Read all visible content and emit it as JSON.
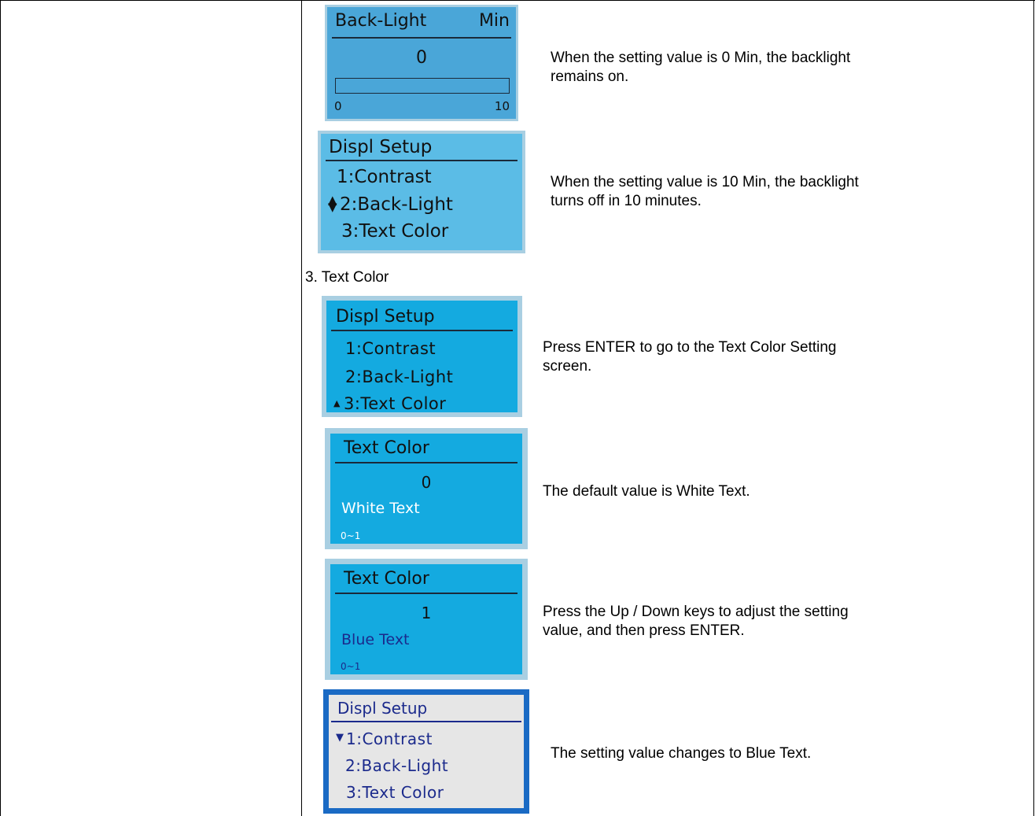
{
  "screens": {
    "backlight_value": {
      "title": "Back-Light",
      "unit": "Min",
      "value": "0",
      "range_min": "0",
      "range_max": "10",
      "bar_fill": 0
    },
    "displ_setup_backlight": {
      "title": "Displ Setup",
      "items": [
        "1:Contrast",
        "2:Back-Light",
        "3:Text Color"
      ],
      "cursor": "updown-arrow"
    },
    "displ_setup_textcolor": {
      "title": "Displ Setup",
      "items": [
        "1:Contrast",
        "2:Back-Light",
        "3:Text Color"
      ],
      "cursor": "up-arrow"
    },
    "text_color_white": {
      "title": "Text Color",
      "value": "0",
      "label": "White Text",
      "range": "0~1"
    },
    "text_color_blue": {
      "title": "Text Color",
      "value": "1",
      "label": "Blue Text",
      "range": "0~1"
    },
    "displ_setup_blue": {
      "title": "Displ Setup",
      "items": [
        "1:Contrast",
        "2:Back-Light",
        "3:Text Color"
      ],
      "cursor": "down-arrow"
    }
  },
  "descriptions": {
    "d1": [
      "When the setting value is 0 Min, the backlight",
      "remains on."
    ],
    "d2": [
      "When the setting value is 10 Min, the backlight",
      "turns off in 10 minutes."
    ],
    "d3": [
      "Press ENTER to go to the Text Color Setting",
      "screen."
    ],
    "d4": [
      "The default value is White Text."
    ],
    "d5": [
      "Press the Up / Down keys to adjust the setting",
      "value, and then press ENTER."
    ],
    "d6": [
      "The setting value changes to Blue Text."
    ]
  },
  "section_heading": "3. Text Color",
  "colors": {
    "lcd_blue": "#14aae0",
    "lcd_blue_light": "#5bbce6",
    "lcd_bezel": "#a9cfe2",
    "lcd_gray": "#e6e6e6",
    "lcd_gray_border": "#1a6ac4",
    "blue_text": "#1b2a8c"
  }
}
